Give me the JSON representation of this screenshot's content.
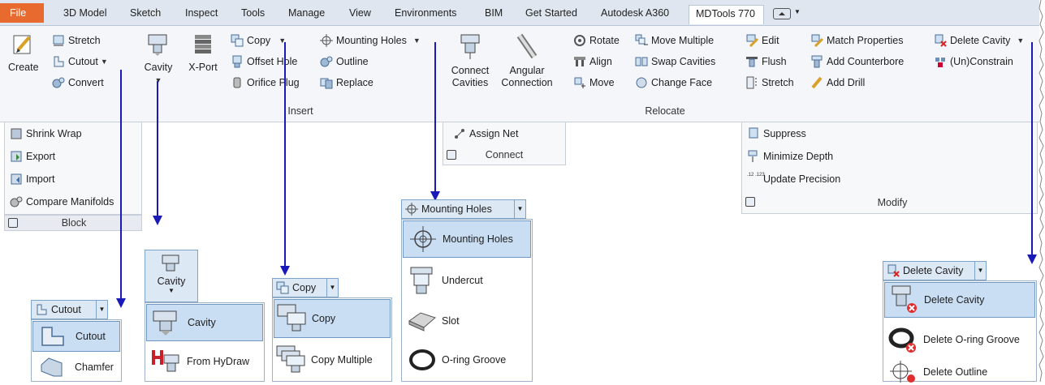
{
  "tabs": [
    "File",
    "3D Model",
    "Sketch",
    "Inspect",
    "Tools",
    "Manage",
    "View",
    "Environments",
    "BIM",
    "Get Started",
    "Autodesk A360",
    "MDTools 770"
  ],
  "ribbon": {
    "create": {
      "label": "Create",
      "stretch": "Stretch",
      "cutout": "Cutout",
      "convert": "Convert"
    },
    "insert": {
      "cavity": "Cavity",
      "xport": "X-Port",
      "copy": "Copy",
      "offset_hole": "Offset Hole",
      "orifice_plug": "Orifice Plug",
      "mounting_holes": "Mounting Holes",
      "outline": "Outline",
      "replace": "Replace",
      "panel": "Insert"
    },
    "connect": {
      "connect_cavities_1": "Connect",
      "connect_cavities_2": "Cavities",
      "angular_1": "Angular",
      "angular_2": "Connection",
      "assign_net": "Assign Net",
      "panel": "Connect"
    },
    "relocate": {
      "rotate": "Rotate",
      "align": "Align",
      "move": "Move",
      "move_multiple": "Move Multiple",
      "swap_cavities": "Swap Cavities",
      "change_face": "Change Face",
      "panel": "Relocate"
    },
    "modify": {
      "edit": "Edit",
      "flush": "Flush",
      "stretch": "Stretch",
      "match_properties": "Match Properties",
      "add_counterbore": "Add Counterbore",
      "add_drill": "Add Drill",
      "delete_cavity": "Delete Cavity",
      "unconstrain": "(Un)Constrain",
      "suppress": "Suppress",
      "minimize_depth": "Minimize Depth",
      "update_precision": "Update Precision",
      "precision_icon": ".12 .123",
      "panel": "Modify"
    },
    "block": {
      "shrink_wrap": "Shrink Wrap",
      "export": "Export",
      "import": "Import",
      "compare_manifolds": "Compare Manifolds",
      "panel": "Block"
    }
  },
  "flyouts": {
    "cutout": {
      "head": "Cutout",
      "items": [
        "Cutout",
        "Chamfer"
      ]
    },
    "cavity": {
      "head": "Cavity",
      "items": [
        "Cavity",
        "From HyDraw"
      ]
    },
    "copy": {
      "head": "Copy",
      "items": [
        "Copy",
        "Copy Multiple"
      ]
    },
    "mounting": {
      "head": "Mounting Holes",
      "items": [
        "Mounting Holes",
        "Undercut",
        "Slot",
        "O-ring Groove"
      ]
    },
    "delete": {
      "head": "Delete Cavity",
      "items": [
        "Delete Cavity",
        "Delete O-ring Groove",
        "Delete Outline"
      ]
    }
  },
  "colors": {
    "file_tab": "#e86a2f",
    "arrow": "#1a1ab8",
    "selected": "#c9ddf3"
  }
}
